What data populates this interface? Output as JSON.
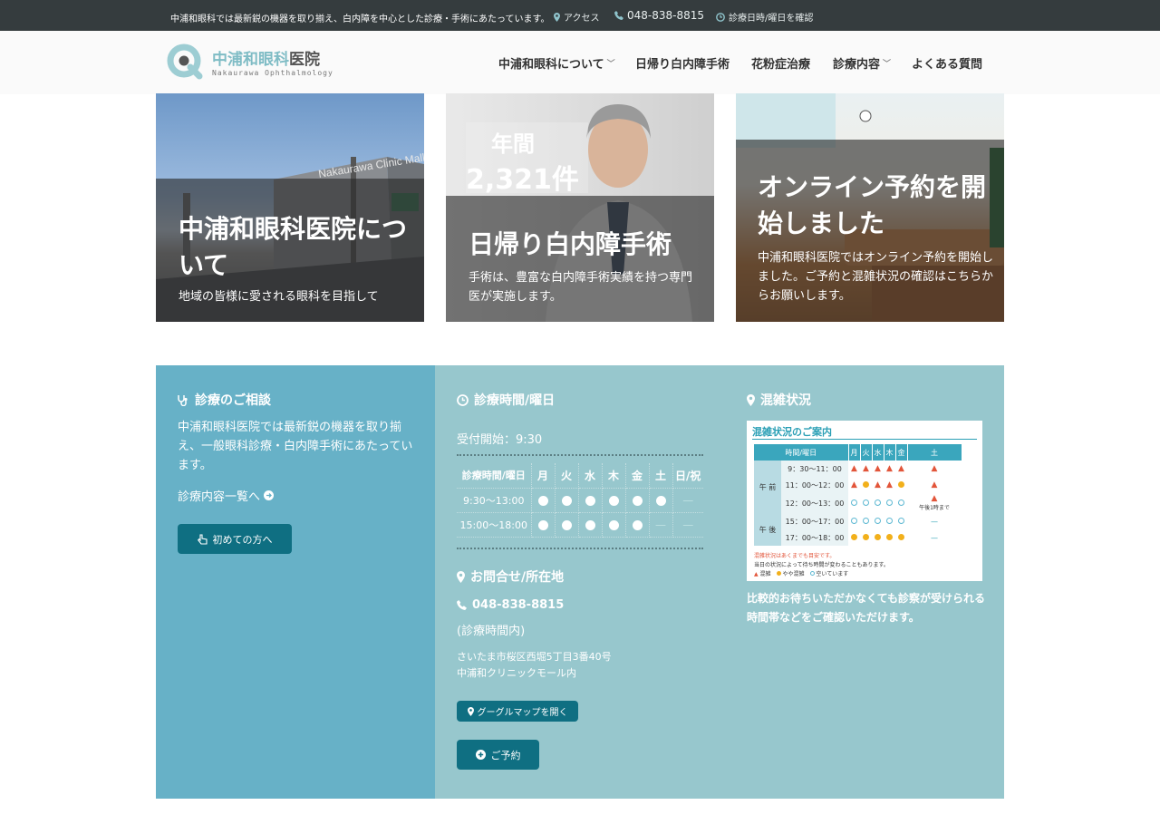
{
  "topbar": {
    "message": "中浦和眼科では最新鋭の機器を取り揃え、白内障を中心とした診療・手術にあたっています。",
    "access": "アクセス",
    "phone": "048-838-8815",
    "schedule": "診療日時/曜日を確認"
  },
  "logo": {
    "jp_main": "中浦和眼科",
    "jp_sub": "医院",
    "en": "Nakaurawa Ophthalmology"
  },
  "nav": {
    "items": [
      {
        "label": "中浦和眼科について",
        "dropdown": true
      },
      {
        "label": "日帰り白内障手術",
        "dropdown": false
      },
      {
        "label": "花粉症治療",
        "dropdown": false
      },
      {
        "label": "診療内容",
        "dropdown": true
      },
      {
        "label": "よくある質問",
        "dropdown": false
      }
    ]
  },
  "cards": [
    {
      "title": "中浦和眼科医院について",
      "desc": "地域の皆様に愛される眼科を目指して",
      "sign": "Nakaurawa Clinic Mall"
    },
    {
      "badge_line1": "年間",
      "badge_line2": "2,321件",
      "title": "日帰り白内障手術",
      "desc": "手術は、豊富な白内障手術実績を持つ専門医が実施します。"
    },
    {
      "title": "オンライン予約を開始しました",
      "desc": "中浦和眼科医院ではオンライン予約を開始しました。ご予約と混雑状況の確認はこちらからお願いします。"
    }
  ],
  "consult": {
    "heading": "診療のご相談",
    "body": "中浦和眼科医院では最新鋭の機器を取り揃え、一般眼科診療・白内障手術にあたっています。",
    "link": "診療内容一覧へ",
    "button": "初めての方へ"
  },
  "hours": {
    "heading": "診療時間/曜日",
    "reception": "受付開始：9:30",
    "columns": [
      "診療時間/曜日",
      "月",
      "火",
      "水",
      "木",
      "金",
      "土",
      "日/祝"
    ],
    "rows": [
      {
        "time": "9:30〜13:00",
        "cells": [
          "open",
          "open",
          "open",
          "open",
          "open",
          "open",
          "closed"
        ]
      },
      {
        "time": "15:00〜18:00",
        "cells": [
          "open",
          "open",
          "open",
          "open",
          "open",
          "closed",
          "closed"
        ]
      }
    ]
  },
  "contact": {
    "heading": "お問合せ/所在地",
    "phone": "048-838-8815",
    "phone_note": "(診療時間内)",
    "address1": "さいたま市桜区西堀5丁目3番40号",
    "address2": "中浦和クリニックモール内",
    "map_button": "グーグルマップを開く",
    "reserve_button": "ご予約"
  },
  "congestion": {
    "heading": "混雑状況",
    "image_title": "混雑状況のご案内",
    "head": [
      "時間/曜日",
      "月",
      "火",
      "水",
      "木",
      "金",
      "土"
    ],
    "am_label": "午 前",
    "pm_label": "午 後",
    "rows": [
      {
        "time": "9：30〜11：00",
        "marks": [
          "tri",
          "tri",
          "tri",
          "tri",
          "tri"
        ],
        "sat": "tri",
        "sat_note": ""
      },
      {
        "time": "11：00〜12：00",
        "marks": [
          "tri",
          "yc",
          "tri",
          "tri",
          "yc"
        ],
        "sat": "tri",
        "sat_note": ""
      },
      {
        "time": "12：00〜13：00",
        "marks": [
          "bc",
          "bc",
          "bc",
          "bc",
          "bc"
        ],
        "sat": "tri",
        "sat_note": "午後1時まで"
      },
      {
        "time": "15：00〜17：00",
        "marks": [
          "bc",
          "bc",
          "bc",
          "bc",
          "bc"
        ],
        "sat": "dash",
        "sat_note": ""
      },
      {
        "time": "17：00〜18：00",
        "marks": [
          "yc",
          "yc",
          "yc",
          "yc",
          "yc"
        ],
        "sat": "dash",
        "sat_note": ""
      }
    ],
    "note1": "混雑状況はあくまでも目安です。",
    "note2": "当日の状況によって待ち時間が変わることもあります。",
    "legend": [
      "混雑",
      "やや混雑",
      "空いています"
    ],
    "caption": "比較的お待ちいただかなくても診察が受けられる時間帯などをご確認いただけます。"
  }
}
